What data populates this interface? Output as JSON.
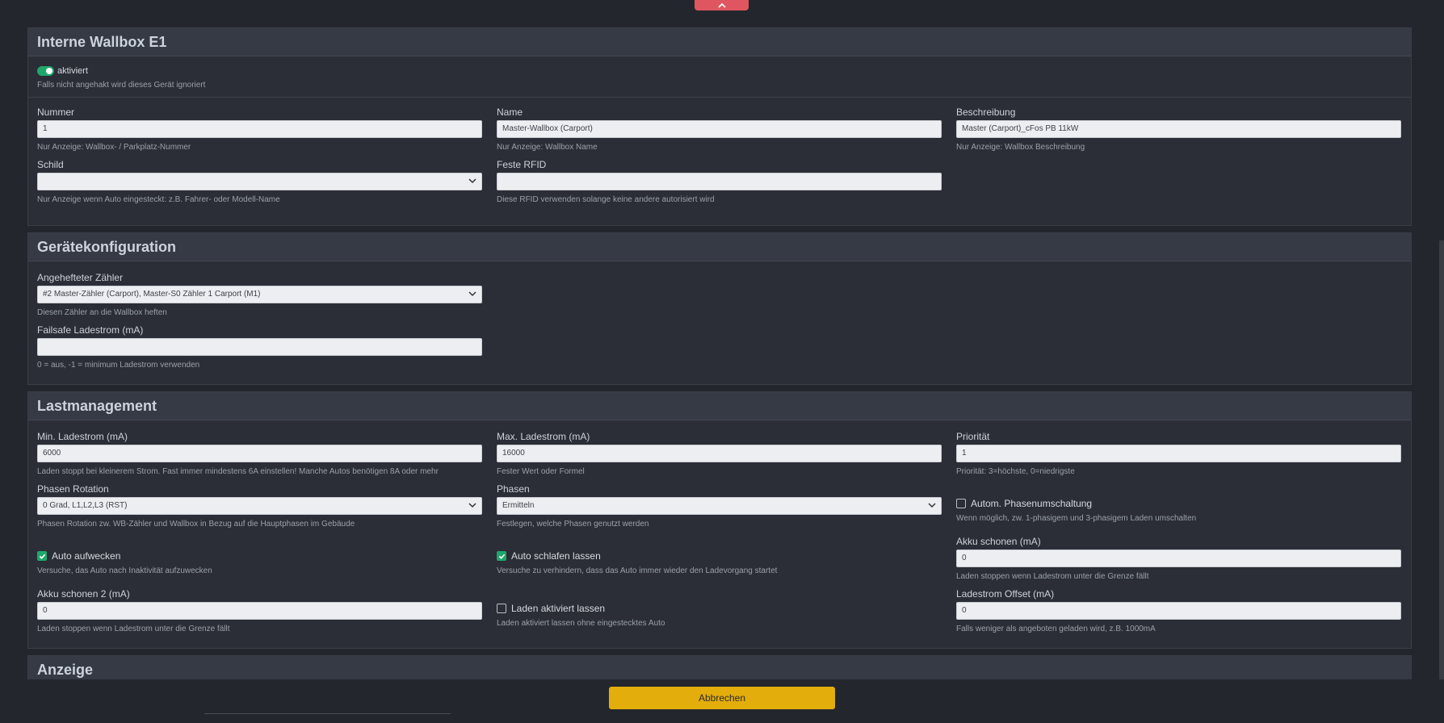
{
  "wallbox": {
    "title": "Interne Wallbox E1",
    "enabled_label": "aktiviert",
    "enabled_help": "Falls nicht angehakt wird dieses Gerät ignoriert",
    "nummer": {
      "label": "Nummer",
      "value": "1",
      "help": "Nur Anzeige: Wallbox- / Parkplatz-Nummer"
    },
    "name": {
      "label": "Name",
      "value": "Master-Wallbox (Carport)",
      "help": "Nur Anzeige: Wallbox Name"
    },
    "beschreibung": {
      "label": "Beschreibung",
      "value": "Master (Carport)_cFos PB 11kW",
      "help": "Nur Anzeige: Wallbox Beschreibung"
    },
    "schild": {
      "label": "Schild",
      "value": "",
      "help": "Nur Anzeige wenn Auto eingesteckt: z.B. Fahrer- oder Modell-Name"
    },
    "rfid": {
      "label": "Feste RFID",
      "value": "",
      "help": "Diese RFID verwenden solange keine andere autorisiert wird"
    }
  },
  "geraet": {
    "title": "Gerätekonfiguration",
    "zaehler": {
      "label": "Angehefteter Zähler",
      "value": "#2 Master-Zähler (Carport), Master-S0 Zähler 1 Carport (M1)",
      "help": "Diesen Zähler an die Wallbox heften"
    },
    "failsafe": {
      "label": "Failsafe Ladestrom (mA)",
      "value": "",
      "help": "0 = aus, -1 = minimum Ladestrom verwenden"
    }
  },
  "last": {
    "title": "Lastmanagement",
    "min": {
      "label": "Min. Ladestrom (mA)",
      "value": "6000",
      "help": "Laden stoppt bei kleinerem Strom. Fast immer mindestens 6A einstellen! Manche Autos benötigen 8A oder mehr"
    },
    "max": {
      "label": "Max. Ladestrom (mA)",
      "value": "16000",
      "help": "Fester Wert oder Formel"
    },
    "prio": {
      "label": "Priorität",
      "value": "1",
      "help": "Priorität: 3=höchste, 0=niedrigste"
    },
    "rotation": {
      "label": "Phasen Rotation",
      "value": "0 Grad, L1,L2,L3 (RST)",
      "help": "Phasen Rotation zw. WB-Zähler und Wallbox in Bezug auf die Hauptphasen im Gebäude"
    },
    "phasen": {
      "label": "Phasen",
      "value": "Ermitteln",
      "help": "Festlegen, welche Phasen genutzt werden"
    },
    "autom": {
      "label": "Autom. Phasenumschaltung",
      "help": "Wenn möglich, zw. 1-phasigem und 3-phasigem Laden umschalten"
    },
    "aufwecken": {
      "label": "Auto aufwecken",
      "help": "Versuche, das Auto nach Inaktivität aufzuwecken"
    },
    "schlafen": {
      "label": "Auto schlafen lassen",
      "help": "Versuche zu verhindern, dass das Auto immer wieder den Ladevorgang startet"
    },
    "akku1": {
      "label": "Akku schonen (mA)",
      "value": "0",
      "help": "Laden stoppen wenn Ladestrom unter die Grenze fällt"
    },
    "akku2": {
      "label": "Akku schonen 2 (mA)",
      "value": "0",
      "help": "Laden stoppen wenn Ladestrom unter die Grenze fällt"
    },
    "aktiv": {
      "label": "Laden aktiviert lassen",
      "help": "Laden aktiviert lassen ohne eingestecktes Auto"
    },
    "offset": {
      "label": "Ladestrom Offset (mA)",
      "value": "0",
      "help": "Falls weniger als angeboten geladen wird, z.B. 1000mA"
    }
  },
  "anzeige": {
    "title": "Anzeige"
  },
  "footer": {
    "cancel_label": "Abbrechen"
  },
  "colors": {
    "accent_green": "#1fa76b",
    "cancel_yellow": "#e3ad0b",
    "top_tab_red": "#e05660"
  },
  "icons": [
    "chevron-up-icon",
    "chevron-down-icon",
    "check-icon"
  ]
}
